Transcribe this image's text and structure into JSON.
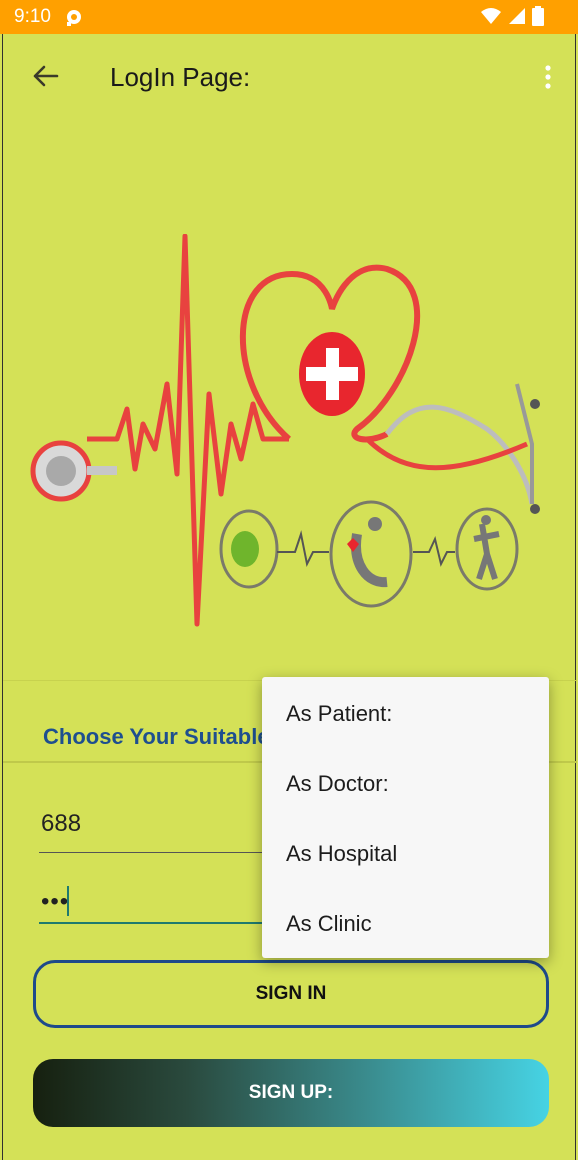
{
  "status_bar": {
    "time": "9:10"
  },
  "app_bar": {
    "title": "LogIn Page:"
  },
  "form": {
    "choose_label": "Choose Your Suitable",
    "username_value": "688",
    "password_value": "•••",
    "signin_label": "SIGN IN",
    "signup_label": "SIGN UP:"
  },
  "dropdown": {
    "options": [
      "As Patient:",
      "As Doctor:",
      "As Hospital",
      "As Clinic"
    ]
  },
  "colors": {
    "background": "#d4e157",
    "status_bar": "#ffa000",
    "accent_blue": "#1e4a8a",
    "gradient_start": "#16200f",
    "gradient_end": "#46d3e4"
  }
}
